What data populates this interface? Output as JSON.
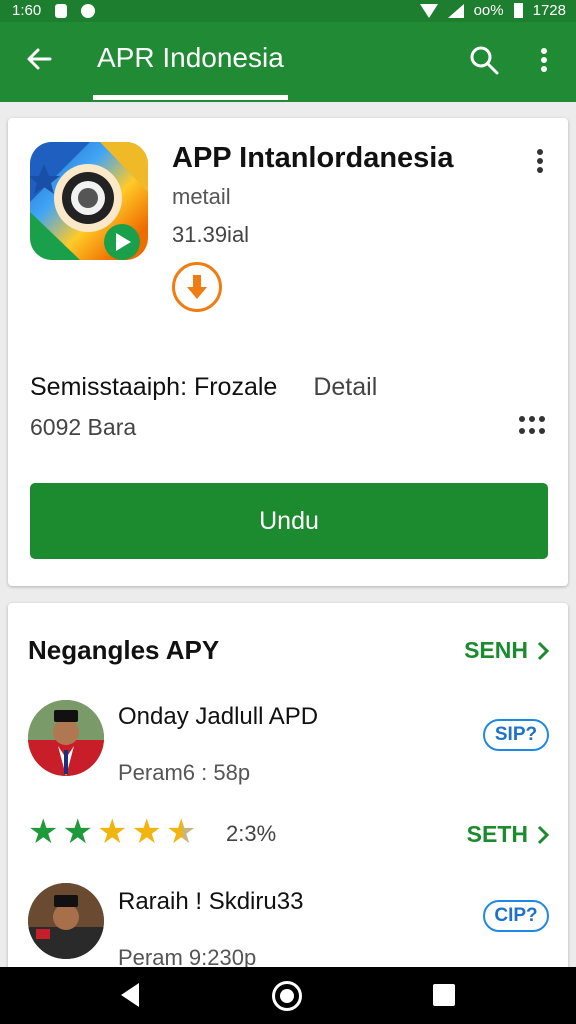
{
  "status_bar": {
    "time": "1:60",
    "battery_text": "oo%",
    "clock_right": "1728"
  },
  "app_bar": {
    "title": "APR Indonesia"
  },
  "app_card": {
    "name": "APP Intanlordanesia",
    "developer": "metail",
    "size": "31.39ial",
    "meta_title": "Semisstaaiph: Frozale",
    "meta_detail": "Detail",
    "meta_sub": "6092 Bara",
    "button_label": "Undu"
  },
  "related": {
    "section_title": "Negangles APY",
    "see_all_label": "SENH",
    "items": [
      {
        "title": "Onday Jadlull APD",
        "subtitle": "Peram6 : 58p",
        "pill": "SIP?"
      },
      {
        "title": "Raraih ! Skdiru33",
        "subtitle": "Peram 9:230p",
        "pill": "CIP?"
      }
    ],
    "rating_text": "2:3%",
    "rating_link_label": "SETH"
  },
  "colors": {
    "primary": "#218a34",
    "accent": "#ef7d14",
    "link_blue": "#1e88e5"
  }
}
